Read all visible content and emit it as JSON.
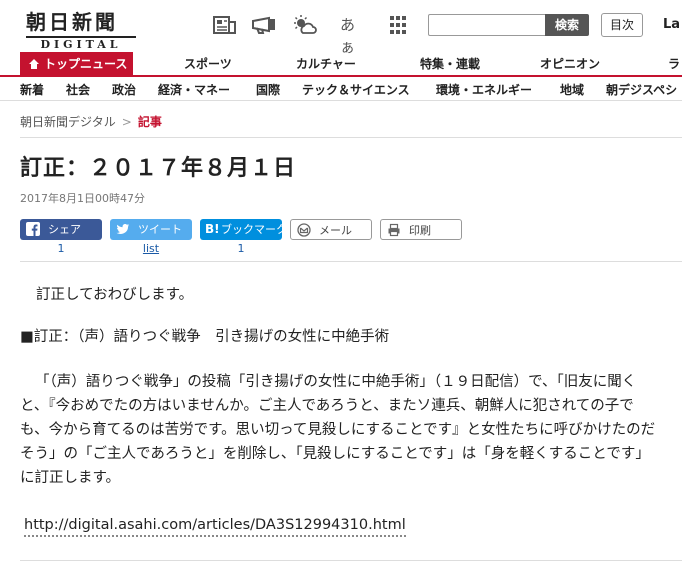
{
  "header": {
    "logo_main": "朝日新聞",
    "logo_sub": "DIGITAL",
    "icons": [
      "newspaper-icon",
      "mail-megaphone-icon",
      "weather-icon",
      "text-size-icon",
      "grid-menu-icon"
    ],
    "text_size_label": "あぁ",
    "search_placeholder": "",
    "search_button": "検索",
    "menu_button": "目次",
    "language": "La"
  },
  "nav_primary": {
    "items": [
      "トップニュース",
      "スポーツ",
      "カルチャー",
      "特集・連載",
      "オピニオン",
      "ラ"
    ],
    "active_index": 0,
    "accent_color": "#c4122f"
  },
  "nav_secondary": {
    "items": [
      "新着",
      "社会",
      "政治",
      "経済・マネー",
      "国際",
      "テック＆サイエンス",
      "環境・エネルギー",
      "地域",
      "朝デジスペシ"
    ]
  },
  "breadcrumb": {
    "root": "朝日新聞デジタル",
    "separator": ">",
    "current": "記事"
  },
  "article": {
    "title": "訂正：２０１７年８月１日",
    "published": "2017年8月1日00時47分",
    "share": {
      "facebook_label": "シェア",
      "facebook_count": "1",
      "twitter_label": "ツイート",
      "twitter_count": "list",
      "hatena_label": "ブックマーク",
      "hatena_count": "1",
      "mail_label": "メール",
      "print_label": "印刷"
    },
    "paragraphs": [
      "訂正しておわびします。",
      "■訂正：（声）語りつぐ戦争　引き揚げの女性に中絶手術",
      "「（声）語りつぐ戦争」の投稿「引き揚げの女性に中絶手術」（１９日配信）で、「旧友に聞くと、『今おめでたの方はいませんか。ご主人であろうと、またソ連兵、朝鮮人に犯されての子でも、今から育てるのは苦労です。思い切って見殺しにすることです』と女性たちに呼びかけたのだそう」の「ご主人であろうと」を削除し、「見殺しにすることです」は「身を軽くすることです」に訂正します。"
    ],
    "url": "http://digital.asahi.com/articles/DA3S12994310.html"
  }
}
